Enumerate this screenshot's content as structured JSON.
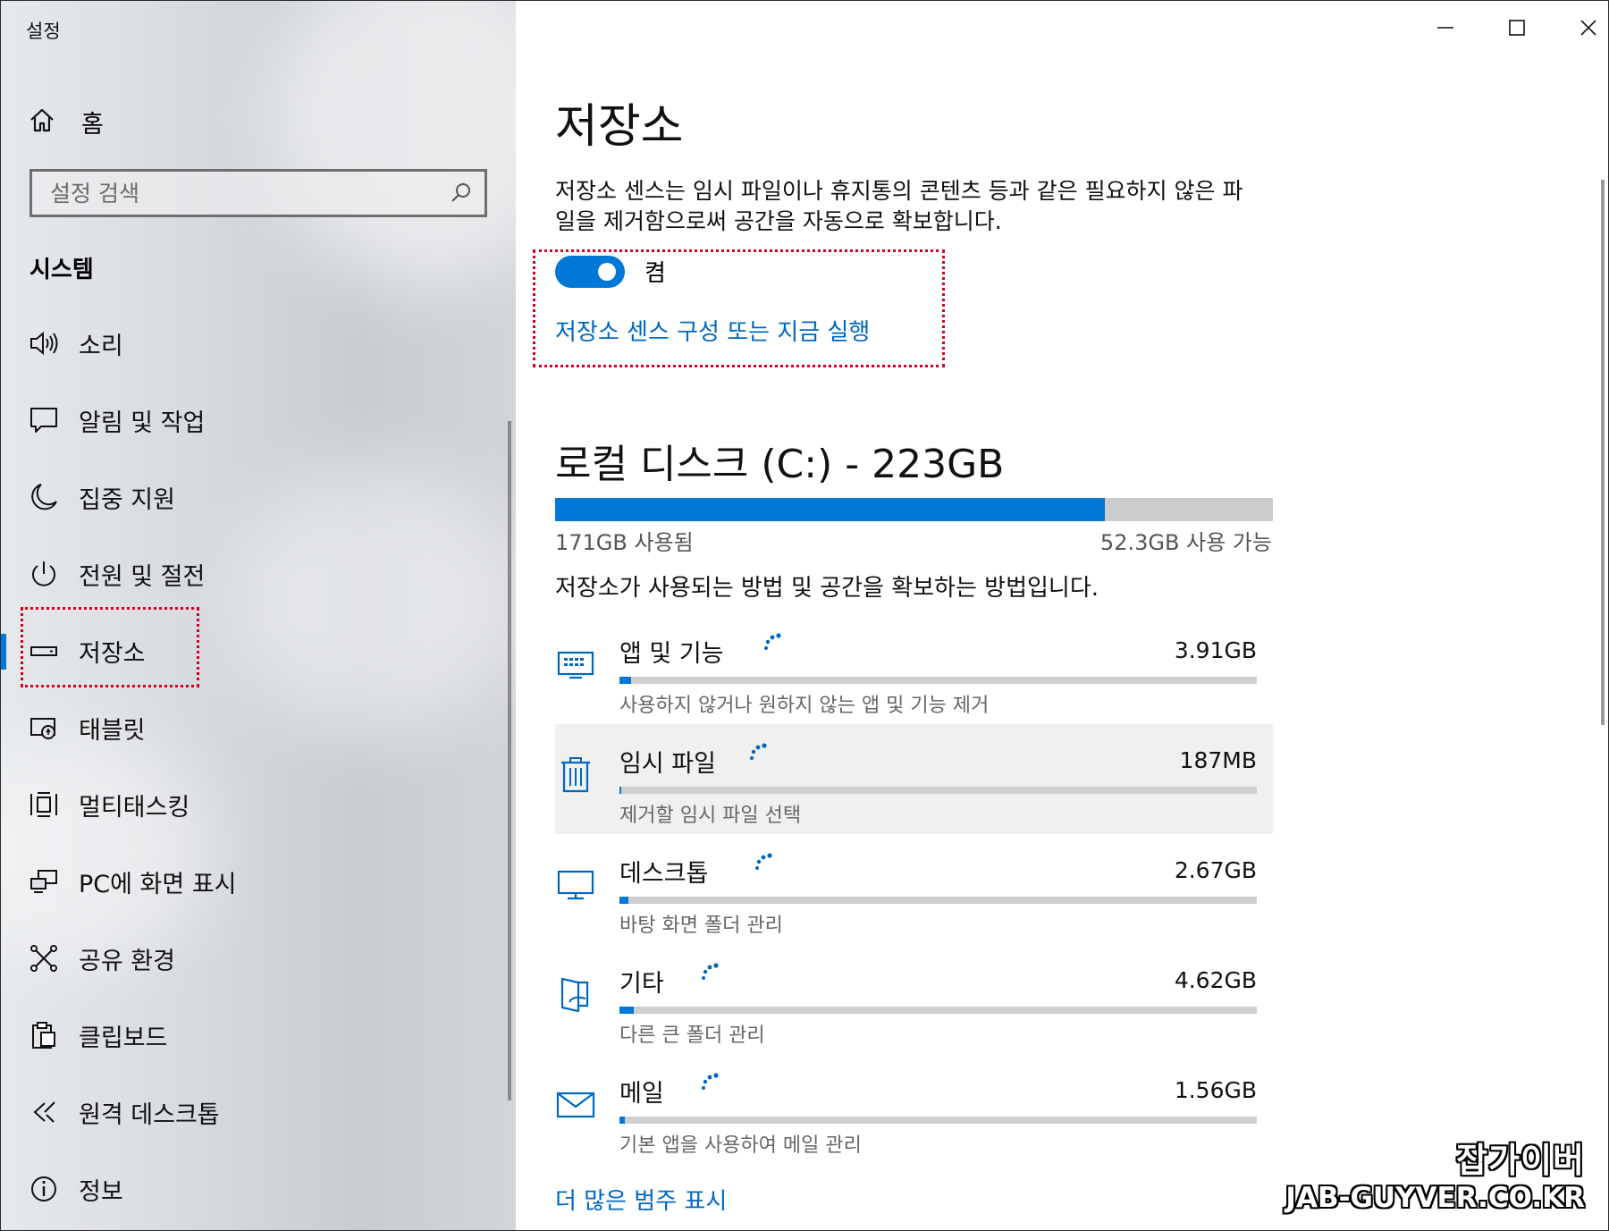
{
  "window": {
    "title": "설정",
    "minimize_icon": "minimize-icon",
    "maximize_icon": "maximize-icon",
    "close_icon": "close-icon"
  },
  "sidebar": {
    "home_label": "홈",
    "search_placeholder": "설정 검색",
    "section_header": "시스템",
    "items": [
      {
        "label": "소리",
        "icon": "speaker-icon"
      },
      {
        "label": "알림 및 작업",
        "icon": "notification-icon"
      },
      {
        "label": "집중 지원",
        "icon": "moon-icon"
      },
      {
        "label": "전원 및 절전",
        "icon": "power-icon"
      },
      {
        "label": "저장소",
        "icon": "storage-icon",
        "active": true
      },
      {
        "label": "태블릿",
        "icon": "tablet-icon"
      },
      {
        "label": "멀티태스킹",
        "icon": "multitasking-icon"
      },
      {
        "label": "PC에 화면 표시",
        "icon": "project-icon"
      },
      {
        "label": "공유 환경",
        "icon": "shared-experience-icon"
      },
      {
        "label": "클립보드",
        "icon": "clipboard-icon"
      },
      {
        "label": "원격 데스크톱",
        "icon": "remote-desktop-icon"
      },
      {
        "label": "정보",
        "icon": "info-icon"
      }
    ]
  },
  "main": {
    "title": "저장소",
    "description": "저장소 센스는 임시 파일이나 휴지통의 콘텐츠 등과 같은 필요하지 않은 파일을 제거함으로써 공간을 자동으로 확보합니다.",
    "toggle_label": "켬",
    "toggle_on": true,
    "sense_link": "저장소 센스 구성 또는 지금 실행",
    "disk": {
      "title": "로컬 디스크 (C:) - 223GB",
      "used_label": "171GB 사용됨",
      "free_label": "52.3GB 사용 가능",
      "used_fraction": 0.766
    },
    "how_text": "저장소가 사용되는 방법 및 공간을 확보하는 방법입니다.",
    "categories": [
      {
        "name": "앱 및 기능",
        "size": "3.91GB",
        "sub": "사용하지 않거나 원하지 않는 앱 및 기능 제거",
        "icon": "apps-icon",
        "fraction": 0.018
      },
      {
        "name": "임시 파일",
        "size": "187MB",
        "sub": "제거할 임시 파일 선택",
        "icon": "trash-icon",
        "fraction": 0.002,
        "highlighted": true
      },
      {
        "name": "데스크톱",
        "size": "2.67GB",
        "sub": "바탕 화면 폴더 관리",
        "icon": "desktop-icon",
        "fraction": 0.014
      },
      {
        "name": "기타",
        "size": "4.62GB",
        "sub": "다른 큰 폴더 관리",
        "icon": "folder-icon",
        "fraction": 0.022
      },
      {
        "name": "메일",
        "size": "1.56GB",
        "sub": "기본 앱을 사용하여 메일 관리",
        "icon": "mail-icon",
        "fraction": 0.009
      }
    ],
    "more_link": "더 많은 범주 표시"
  },
  "watermark": {
    "line1": "잡가이버",
    "line2": "JAB-GUYVER.CO.KR"
  },
  "colors": {
    "accent": "#0078d7",
    "link": "#0067c0",
    "annotation": "#d6001c"
  }
}
